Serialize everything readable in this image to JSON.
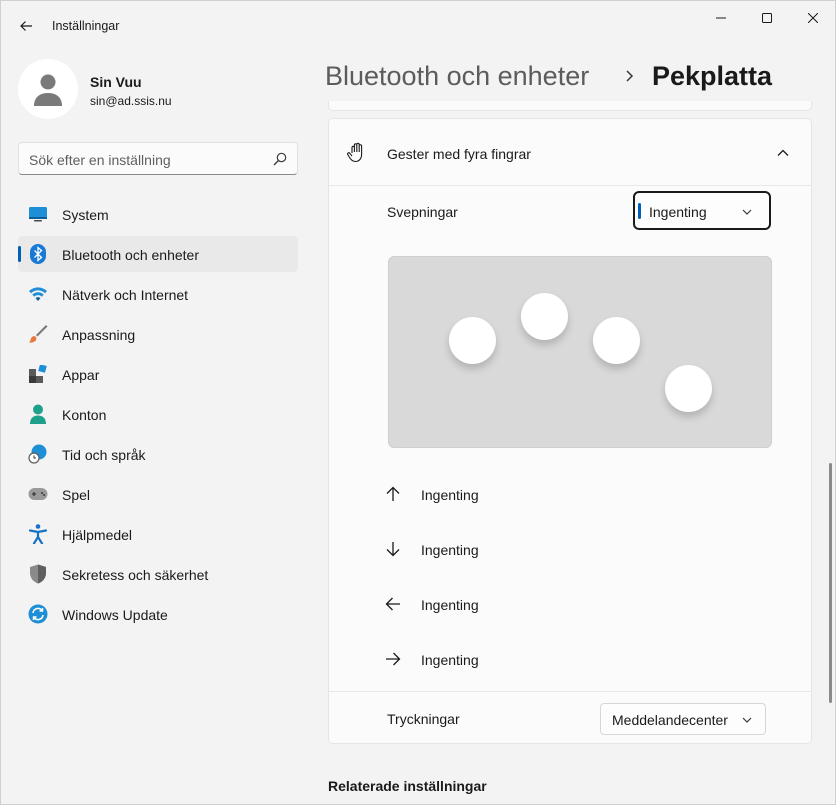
{
  "window": {
    "title": "Inställningar"
  },
  "user": {
    "name": "Sin Vuu",
    "email": "sin@ad.ssis.nu"
  },
  "search": {
    "placeholder": "Sök efter en inställning"
  },
  "sidebar": {
    "items": [
      {
        "label": "System",
        "icon": "monitor-icon"
      },
      {
        "label": "Bluetooth och enheter",
        "icon": "bluetooth-icon",
        "selected": true
      },
      {
        "label": "Nätverk och Internet",
        "icon": "wifi-icon"
      },
      {
        "label": "Anpassning",
        "icon": "brush-icon"
      },
      {
        "label": "Appar",
        "icon": "apps-icon"
      },
      {
        "label": "Konton",
        "icon": "person-icon"
      },
      {
        "label": "Tid och språk",
        "icon": "globe-clock-icon"
      },
      {
        "label": "Spel",
        "icon": "gamepad-icon"
      },
      {
        "label": "Hjälpmedel",
        "icon": "accessibility-icon"
      },
      {
        "label": "Sekretess och säkerhet",
        "icon": "shield-icon"
      },
      {
        "label": "Windows Update",
        "icon": "update-icon"
      }
    ]
  },
  "breadcrumb": {
    "parent": "Bluetooth och enheter",
    "current": "Pekplatta"
  },
  "card": {
    "title": "Gester med fyra fingrar",
    "swipes": {
      "label": "Svepningar",
      "value": "Ingenting"
    },
    "directions": [
      {
        "dir": "up",
        "label": "Ingenting",
        "icon": "arrow-up-icon"
      },
      {
        "dir": "down",
        "label": "Ingenting",
        "icon": "arrow-down-icon"
      },
      {
        "dir": "left",
        "label": "Ingenting",
        "icon": "arrow-left-icon"
      },
      {
        "dir": "right",
        "label": "Ingenting",
        "icon": "arrow-right-icon"
      }
    ],
    "taps": {
      "label": "Tryckningar",
      "value": "Meddelandecenter"
    }
  },
  "related": {
    "title": "Relaterade inställningar"
  },
  "colors": {
    "accent": "#005fb8",
    "background": "#f3f3f3",
    "card": "#fbfbfb",
    "preview": "#d9d9d9"
  }
}
